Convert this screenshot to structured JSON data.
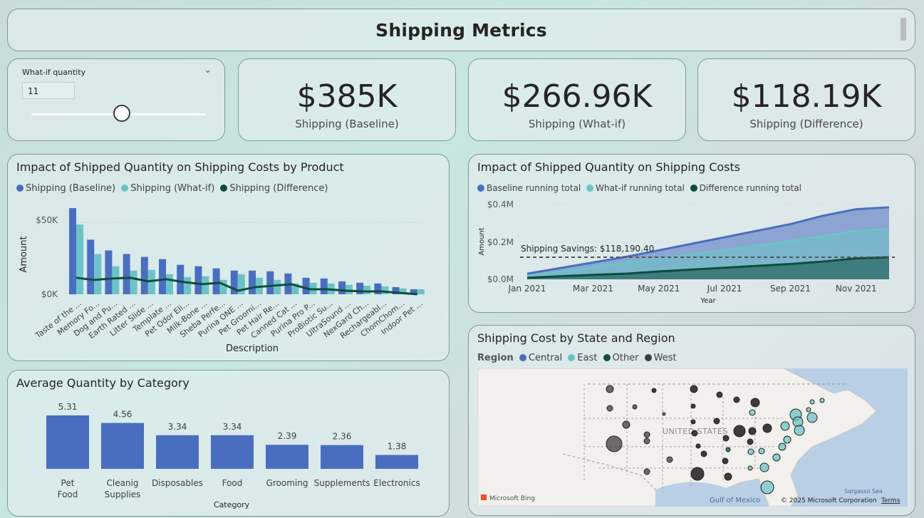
{
  "title": "Shipping Metrics",
  "slicer": {
    "label": "What-if quantity",
    "value": "11",
    "slider_fraction": 0.52
  },
  "kpis": [
    {
      "value": "$385K",
      "label": "Shipping (Baseline)"
    },
    {
      "value": "$266.96K",
      "label": "Shipping (What-if)"
    },
    {
      "value": "$118.19K",
      "label": "Shipping (Difference)"
    }
  ],
  "colors": {
    "baseline": "#4a6ebf",
    "whatif": "#6cc3c7",
    "difference": "#0e4d3d",
    "other": "#0e4d3d",
    "west": "#3d3d3d"
  },
  "product_chart": {
    "title": "Impact of Shipped Quantity on Shipping Costs by Product",
    "legend": [
      "Shipping (Baseline)",
      "Shipping (What-if)",
      "Shipping (Difference)"
    ],
    "ylabel": "Amount",
    "xlabel": "Description",
    "yticks": [
      "$50K",
      "$0K"
    ]
  },
  "running_chart": {
    "title": "Impact of Shipped Quantity on Shipping Costs",
    "legend": [
      "Baseline running total",
      "What-if running total",
      "Difference running total"
    ],
    "ylabel": "Amount",
    "xlabel": "Year",
    "yticks": [
      "$0.4M",
      "$0.2M",
      "$0.0M"
    ],
    "xticks": [
      "Jan 2021",
      "Mar 2021",
      "May 2021",
      "Jul 2021",
      "Sep 2021",
      "Nov 2021"
    ],
    "annotation": "Shipping Savings: $118,190.40"
  },
  "category_chart": {
    "title": "Average Quantity by Category",
    "xlabel": "Category"
  },
  "map_chart": {
    "title": "Shipping Cost by State and Region",
    "legend_title": "Region",
    "legend": [
      "Central",
      "East",
      "Other",
      "West"
    ],
    "country_label": "UNITED STATES",
    "gulf_label": "Gulf of Mexico",
    "sea_label": "Sargasso Sea",
    "bing": "Microsoft Bing",
    "copyright": "© 2025 Microsoft Corporation",
    "terms": "Terms"
  },
  "chart_data": [
    {
      "type": "bar",
      "title": "Impact of Shipped Quantity on Shipping Costs by Product",
      "xlabel": "Description",
      "ylabel": "Amount",
      "ylim": [
        0,
        62000
      ],
      "categories": [
        "Taste of the ...",
        "Memory Fo...",
        "Dog and Pu...",
        "Earth Rated ...",
        "Litter Slide ...",
        "Template ...",
        "Pet Odor Eli...",
        "Milk-Bone ...",
        "Sheba Perfe...",
        "Purina ONE ...",
        "Pet Groomi...",
        "Pet Hair Re...",
        "Canned Cat ...",
        "Purina Pro P...",
        "ProBiotic Su...",
        "UltraSound ...",
        "NexGard Ch...",
        "Rechargeabl...",
        "ChomChom...",
        "Indoor Pet ..."
      ],
      "series": [
        {
          "name": "Shipping (Baseline)",
          "values": [
            60000,
            38000,
            30500,
            28000,
            26000,
            24500,
            20500,
            19500,
            18000,
            16500,
            16500,
            16000,
            14500,
            11500,
            11000,
            9000,
            8000,
            7500,
            5000,
            3500
          ]
        },
        {
          "name": "Shipping (What-if)",
          "values": [
            48500,
            28000,
            19500,
            16500,
            17000,
            14000,
            12000,
            12500,
            10000,
            14000,
            11500,
            10000,
            7500,
            8000,
            7500,
            6500,
            6000,
            5500,
            4000,
            3500
          ]
        },
        {
          "name": "Shipping (Difference)",
          "values": [
            11500,
            10000,
            11000,
            11500,
            9000,
            10500,
            8500,
            7000,
            8000,
            2500,
            5000,
            6000,
            7000,
            3500,
            3500,
            2500,
            2000,
            2000,
            1000,
            0
          ]
        }
      ]
    },
    {
      "type": "area",
      "title": "Impact of Shipped Quantity on Shipping Costs",
      "xlabel": "Year",
      "ylabel": "Amount",
      "ylim": [
        0,
        400000
      ],
      "x": [
        "Jan 2021",
        "Feb 2021",
        "Mar 2021",
        "Apr 2021",
        "May 2021",
        "Jun 2021",
        "Jul 2021",
        "Aug 2021",
        "Sep 2021",
        "Oct 2021",
        "Nov 2021",
        "Dec 2021"
      ],
      "series": [
        {
          "name": "Baseline running total",
          "values": [
            30000,
            60000,
            90000,
            120000,
            155000,
            190000,
            225000,
            260000,
            295000,
            340000,
            375000,
            385000
          ]
        },
        {
          "name": "What-if running total",
          "values": [
            20000,
            40000,
            65000,
            90000,
            110000,
            135000,
            155000,
            180000,
            205000,
            230000,
            260000,
            266960
          ]
        },
        {
          "name": "Difference running total",
          "values": [
            8000,
            16000,
            24000,
            30000,
            42000,
            52000,
            62000,
            72000,
            82000,
            95000,
            112000,
            118190
          ]
        }
      ],
      "reference_line": 118190.4
    },
    {
      "type": "bar",
      "title": "Average Quantity by Category",
      "xlabel": "Category",
      "ylabel": "",
      "categories": [
        "Pet Food",
        "Cleanig Supplies",
        "Disposables",
        "Food",
        "Grooming",
        "Supplements",
        "Electronics"
      ],
      "values": [
        5.31,
        4.56,
        3.34,
        3.34,
        2.39,
        2.36,
        1.38
      ]
    }
  ]
}
